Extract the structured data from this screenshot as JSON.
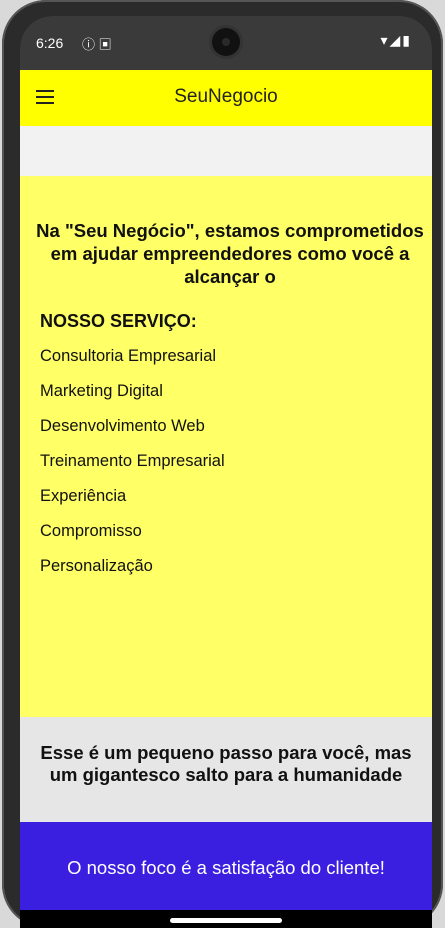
{
  "status": {
    "time": "6:26",
    "left_icons": "ⓘ ▣",
    "right_icons": "▾◢▮"
  },
  "app_bar": {
    "title": "SeuNegocio"
  },
  "intro": {
    "text": "Na \"Seu Negócio\", estamos comprometidos em ajudar empreendedores como você a alcançar o"
  },
  "services": {
    "heading": "NOSSO SERVIÇO:",
    "items": [
      "Consultoria Empresarial",
      "Marketing Digital",
      "Desenvolvimento Web",
      "Treinamento Empresarial",
      "Experiência",
      "Compromisso",
      "Personalização"
    ]
  },
  "quote": {
    "text": "Esse é um pequeno passo para você, mas um gigantesco salto para a humanidade"
  },
  "footer": {
    "text": "O nosso foco é a satisfação do cliente!"
  },
  "colors": {
    "app_bar": "#ffff00",
    "main_panel": "#ffff66",
    "quote_panel": "#e6e6e6",
    "footer_panel": "#3a1fe0"
  }
}
